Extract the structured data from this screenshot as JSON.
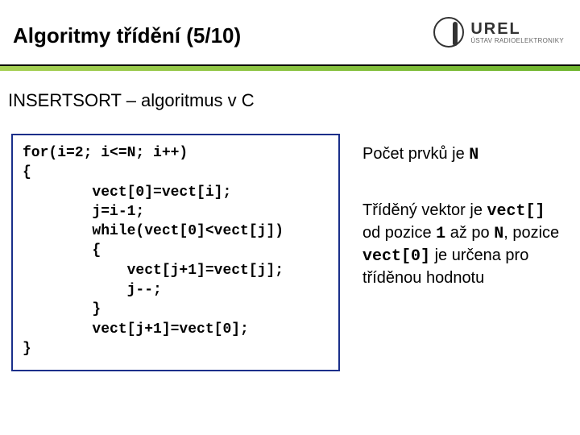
{
  "header": {
    "title": "Algoritmy třídění (5/10)",
    "logo_name": "UREL",
    "logo_sub": "ÚSTAV RADIOELEKTRONIKY"
  },
  "subtitle": "INSERTSORT – algoritmus v C",
  "code": {
    "l1": "for(i=2; i<=N; i++)",
    "l2": "{",
    "l3": "        vect[0]=vect[i];",
    "l4": "        j=i-1;",
    "l5": "        while(vect[0]<vect[j])",
    "l6": "        {",
    "l7": "            vect[j+1]=vect[j];",
    "l8": "            j--;",
    "l9": "        }",
    "l10": "        vect[j+1]=vect[0];",
    "l11": "}"
  },
  "side": {
    "p1_a": "Počet prvků je ",
    "p1_N": "N",
    "p2_a": "Tříděný vektor je ",
    "p2_vect": "vect[]",
    "p2_b": " od pozice ",
    "p2_one": "1",
    "p2_c": " až po ",
    "p2_N": "N",
    "p2_d": ", pozice ",
    "p2_vect0": "vect[0]",
    "p2_e": " je určena pro tříděnou hodnotu"
  }
}
